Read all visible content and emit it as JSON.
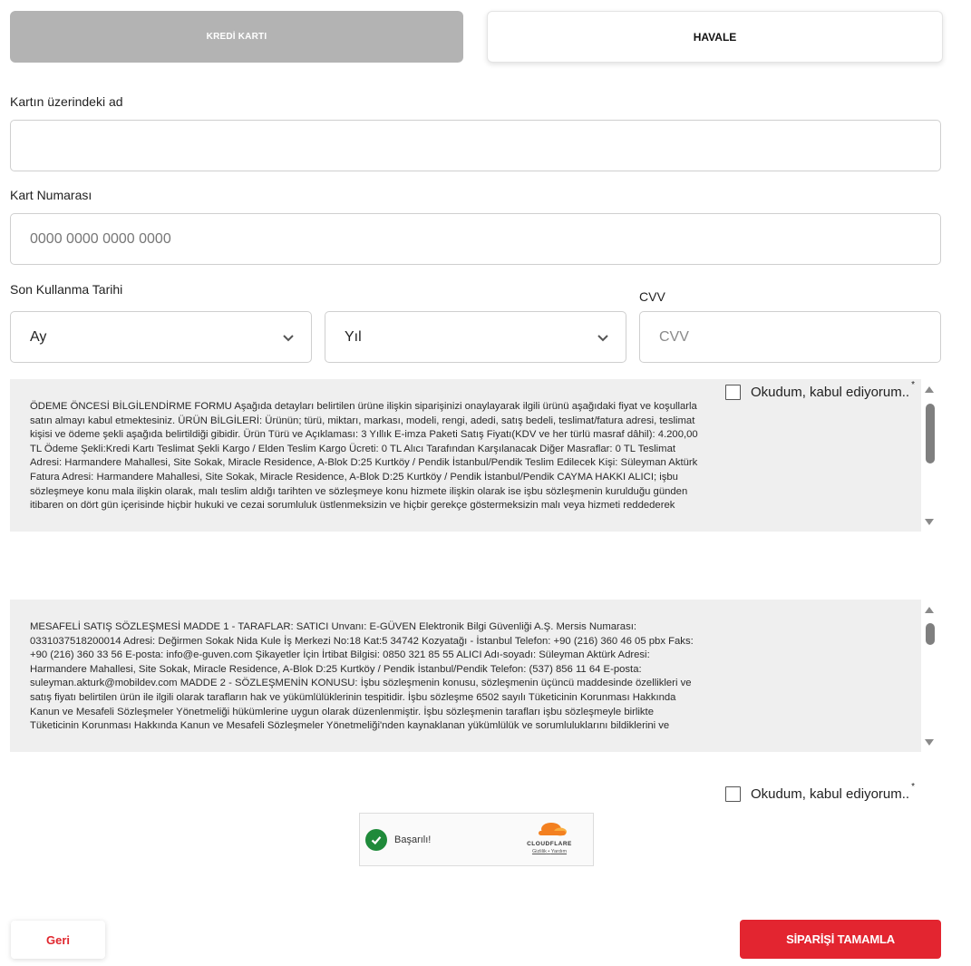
{
  "payment_tabs": {
    "credit_card": "KREDİ KARTI",
    "transfer": "HAVALE"
  },
  "form": {
    "card_name_label": "Kartın üzerindeki ad",
    "card_name_value": "",
    "card_number_label": "Kart Numarası",
    "card_number_placeholder": "0000 0000 0000 0000",
    "expiry_label": "Son Kullanma Tarihi",
    "month_value": "Ay",
    "year_value": "Yıl",
    "cvv_label": "CVV",
    "cvv_placeholder": "CVV"
  },
  "pre_info": {
    "lines": [
      "ÖDEME ÖNCESİ BİLGİLENDİRME FORMU Aşağıda detayları belirtilen ürüne ilişkin siparişinizi onaylayarak ilgili ürünü aşağıdaki fiyat ve koşullarla",
      "satın almayı kabul etmektesiniz. ÜRÜN BİLGİLERİ: Ürünün; türü, miktarı, markası, modeli, rengi, adedi, satış bedeli, teslimat/fatura adresi, teslimat",
      "kişisi ve ödeme şekli aşağıda belirtildiği gibidir. Ürün Türü ve Açıklaması: 3 Yıllık E-imza Paketi Satış Fiyatı(KDV ve her türlü masraf dâhil): 4.200,00",
      "TL Ödeme Şekli:Kredi Kartı Teslimat Şekli Kargo / Elden Teslim Kargo Ücreti: 0 TL Alıcı Tarafından Karşılanacak Diğer Masraflar: 0 TL Teslimat",
      "Adresi: Harmandere Mahallesi, Site Sokak, Miracle Residence, A-Blok D:25 Kurtköy / Pendik İstanbul/Pendik Teslim Edilecek Kişi: Süleyman Aktürk",
      "Fatura Adresi: Harmandere Mahallesi, Site Sokak, Miracle Residence, A-Blok D:25 Kurtköy / Pendik İstanbul/Pendik CAYMA HAKKI ALICI; işbu",
      "sözleşmeye konu mala ilişkin olarak, malı teslim aldığı tarihten ve sözleşmeye konu hizmete ilişkin olarak ise işbu sözleşmenin kurulduğu günden",
      "itibaren on dört gün içerisinde hiçbir hukuki ve cezai sorumluluk üstlenmeksizin ve hiçbir gerekçe göstermeksizin malı veya hizmeti reddederek"
    ],
    "accept_label": "Okudum, kabul ediyorum..",
    "required_mark": "*"
  },
  "contract": {
    "lines": [
      "MESAFELİ SATIŞ SÖZLEŞMESİ MADDE 1 - TARAFLAR: SATICI Unvanı: E-GÜVEN Elektronik Bilgi Güvenliği A.Ş. Mersis Numarası:",
      "0331037518200014 Adresi: Değirmen Sokak Nida Kule İş Merkezi No:18 Kat:5 34742 Kozyatağı - İstanbul Telefon: +90 (216) 360 46 05 pbx Faks:",
      "+90 (216) 360 33 56 E-posta: info@e-guven.com Şikayetler İçin İrtibat Bilgisi: 0850 321 85 55 ALICI Adı-soyadı: Süleyman Aktürk Adresi:",
      "Harmandere Mahallesi, Site Sokak, Miracle Residence, A-Blok D:25 Kurtköy / Pendik İstanbul/Pendik Telefon: (537) 856 11 64 E-posta:",
      "suleyman.akturk@mobildev.com MADDE 2 - SÖZLEŞMENİN KONUSU: İşbu sözleşmenin konusu, sözleşmenin üçüncü maddesinde özellikleri ve",
      "satış fiyatı belirtilen ürün ile ilgili olarak tarafların hak ve yükümlülüklerinin tespitidir. İşbu sözleşme 6502 sayılı Tüketicinin Korunması Hakkında",
      "Kanun ve Mesafeli Sözleşmeler Yönetmeliği hükümlerine uygun olarak düzenlenmiştir. İşbu sözleşmenin tarafları işbu sözleşmeyle birlikte",
      "Tüketicinin Korunması Hakkında Kanun ve Mesafeli Sözleşmeler Yönetmeliği'nden kaynaklanan yükümlülük ve sorumluluklarını bildiklerini ve"
    ],
    "accept_label": "Okudum, kabul ediyorum..",
    "required_mark": "*"
  },
  "captcha": {
    "status": "Başarılı!",
    "brand": "CLOUDFLARE",
    "privacy_link": "Gizlilik",
    "separator": "•",
    "terms_link": "Yardım"
  },
  "actions": {
    "back_label": "Geri",
    "submit_label": "SİPARİŞİ TAMAMLA"
  },
  "colors": {
    "accent_red": "#e32530",
    "tab_active_bg": "#b3b3b3",
    "terms_bg": "#efefef",
    "captcha_success": "#1f8a3a",
    "cloudflare_orange": "#f38020"
  }
}
